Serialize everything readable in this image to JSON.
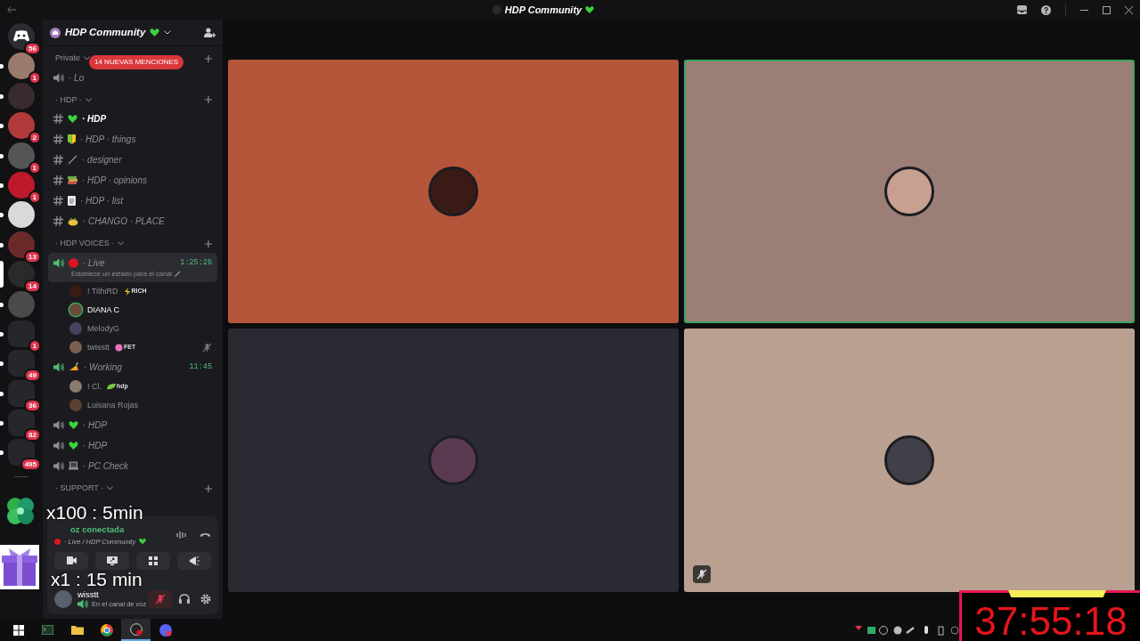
{
  "window": {
    "title": "HDP Community"
  },
  "servers": [
    {
      "kind": "home",
      "badge": "56",
      "unread": false,
      "selected": false,
      "color": "#2b2d31"
    },
    {
      "kind": "avatar",
      "badge": "1",
      "unread": true,
      "selected": false,
      "color": "#9a7a6a"
    },
    {
      "kind": "avatar",
      "unread": true,
      "selected": false,
      "color": "#3a2a2e"
    },
    {
      "kind": "avatar",
      "badge": "2",
      "unread": true,
      "selected": false,
      "color": "#b23a3a"
    },
    {
      "kind": "avatar",
      "badge": "1",
      "unread": true,
      "selected": false,
      "color": "#555555"
    },
    {
      "kind": "avatar",
      "badge": "1",
      "unread": true,
      "selected": false,
      "color": "#c0182b"
    },
    {
      "kind": "avatar",
      "unread": true,
      "selected": false,
      "color": "#d9d9d9"
    },
    {
      "kind": "avatar",
      "badge": "13",
      "unread": true,
      "selected": false,
      "color": "#6b2a2a"
    },
    {
      "kind": "avatar",
      "badge": "14",
      "unread": false,
      "selected": true,
      "color": "#2a2a2a"
    },
    {
      "kind": "avatar",
      "unread": true,
      "selected": false,
      "color": "#4a4a4a"
    },
    {
      "kind": "folder",
      "badge": "1",
      "unread": true,
      "selected": false,
      "color": "#26272b"
    },
    {
      "kind": "folder",
      "badge": "49",
      "unread": true,
      "selected": false,
      "color": "#26272b"
    },
    {
      "kind": "folder",
      "badge": "36",
      "unread": true,
      "selected": false,
      "color": "#26272b"
    },
    {
      "kind": "folder",
      "badge": "82",
      "unread": true,
      "selected": false,
      "color": "#26272b"
    },
    {
      "kind": "folder",
      "badge": "495",
      "unread": true,
      "selected": false,
      "color": "#26272b"
    }
  ],
  "guild": {
    "name": "HDP Community"
  },
  "mention_pill": "14 NUEVAS MENCIONES",
  "categories": [
    {
      "name": "Private",
      "channels": [
        {
          "kind": "voice",
          "name": "· Lo",
          "unread": false,
          "selected": false,
          "active": false
        }
      ]
    },
    {
      "name": "· HDP ·",
      "channels": [
        {
          "kind": "text",
          "emoji": {
            "kind": "heart"
          },
          "name": "· HDP",
          "unread": true,
          "selected": false
        },
        {
          "kind": "text",
          "emoji": {
            "kind": "shield"
          },
          "name": "· HDP · things",
          "unread": false,
          "selected": false
        },
        {
          "kind": "text",
          "emoji": {
            "kind": "pencil"
          },
          "name": "· designer",
          "unread": false,
          "selected": false
        },
        {
          "kind": "text",
          "emoji": {
            "kind": "books"
          },
          "name": "· HDP · opinions",
          "unread": false,
          "selected": false
        },
        {
          "kind": "text",
          "emoji": {
            "kind": "clipboard"
          },
          "name": "· HDP · list",
          "unread": false,
          "selected": false
        },
        {
          "kind": "text",
          "emoji": {
            "kind": "chick"
          },
          "name": "· CHANGO · PLACE",
          "unread": false,
          "selected": false
        }
      ]
    },
    {
      "name": "· HDP VOICES ·",
      "channels": [
        {
          "kind": "voice",
          "emoji": {
            "kind": "record"
          },
          "name": "· Live",
          "unread": false,
          "selected": true,
          "active": true,
          "timer": "1:25:26",
          "status": "Establece un estado para el canal",
          "users": [
            {
              "name": "! TithiRD",
              "badge": {
                "text": "RICH",
                "kind": "bolt"
              },
              "speaking": false,
              "muted": false,
              "color": "#3a1a14"
            },
            {
              "name": "DIANA C",
              "speaking": true,
              "muted": false,
              "color": "#6b4a3a"
            },
            {
              "name": "MelodyG",
              "speaking": false,
              "muted": false,
              "color": "#4a4060"
            },
            {
              "name": "twisstt",
              "badge": {
                "text": "FET",
                "kind": "flower"
              },
              "speaking": false,
              "muted": true,
              "color": "#7a6050"
            }
          ]
        },
        {
          "kind": "voice",
          "emoji": {
            "kind": "cake"
          },
          "name": "· Working",
          "unread": false,
          "selected": false,
          "active": true,
          "timer": "11:45",
          "users": [
            {
              "name": "! Cl.",
              "badge": {
                "text": "hdp",
                "kind": "leaf"
              },
              "speaking": false,
              "muted": false,
              "color": "#8a7a70"
            },
            {
              "name": "Luisana Rojas",
              "speaking": false,
              "muted": false,
              "color": "#5a4030"
            }
          ]
        },
        {
          "kind": "voice",
          "emoji": {
            "kind": "heart"
          },
          "name": "· HDP",
          "unread": false,
          "selected": false,
          "active": false
        },
        {
          "kind": "voice",
          "emoji": {
            "kind": "heart"
          },
          "name": "· HDP",
          "unread": false,
          "selected": false,
          "active": false
        },
        {
          "kind": "voice",
          "emoji": {
            "kind": "laptop"
          },
          "name": "· PC Check",
          "unread": false,
          "selected": false,
          "active": false
        }
      ]
    },
    {
      "name": "· SUPPORT ·"
    }
  ],
  "voice_panel": {
    "status": "oz conectada",
    "channel": "· Live / HDP Community"
  },
  "user_panel": {
    "name": "wisstt",
    "status": "En el canal de voz",
    "mic_muted": true
  },
  "tiles": [
    {
      "color": "#b5553a",
      "selected": false,
      "muted": false,
      "avatar": {
        "color": "#3a1a14"
      }
    },
    {
      "color": "#9b7f77",
      "selected": true,
      "muted": false,
      "avatar": {
        "color": "#c8a090"
      }
    },
    {
      "color": "#2b2a33",
      "selected": false,
      "muted": false,
      "avatar": {
        "color": "#5a3a50"
      }
    },
    {
      "color": "#b9a091",
      "selected": false,
      "muted": true,
      "avatar": {
        "color": "#404048"
      }
    }
  ],
  "overlays": [
    {
      "kind": "clover",
      "text": "x100 : 5min"
    },
    {
      "kind": "gift",
      "text": "x1 : 15 min"
    }
  ],
  "timer": {
    "text": "37:55:18"
  },
  "taskbar": [
    {
      "kind": "start",
      "selected": false
    },
    {
      "kind": "terminal",
      "selected": false
    },
    {
      "kind": "folder",
      "selected": false
    },
    {
      "kind": "browser",
      "selected": false
    },
    {
      "kind": "recorder",
      "selected": true
    },
    {
      "kind": "chat",
      "selected": false
    }
  ]
}
